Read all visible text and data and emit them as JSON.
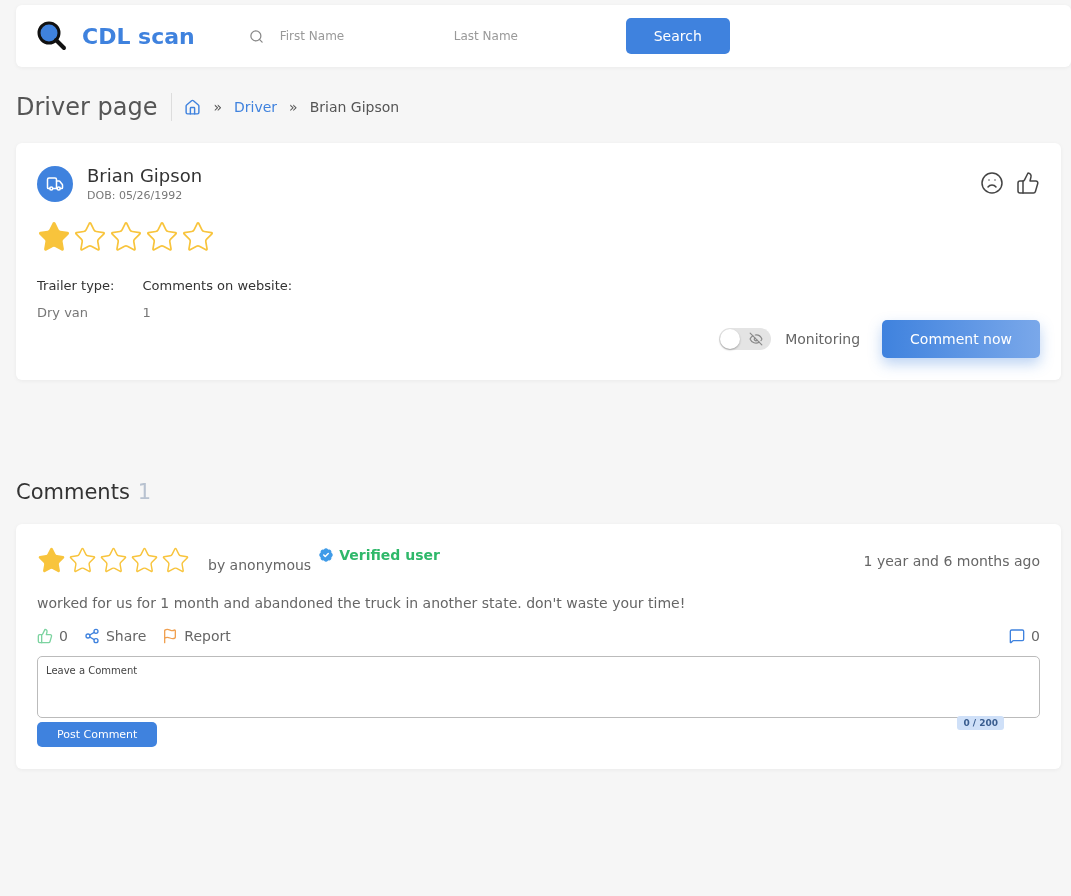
{
  "header": {
    "logo": "CDL scan",
    "search": {
      "first_name_placeholder": "First Name",
      "last_name_placeholder": "Last Name",
      "button": "Search"
    }
  },
  "page_title": "Driver page",
  "breadcrumb": [
    {
      "separator": "»",
      "label": "Driver",
      "kind": "link"
    },
    {
      "separator": "»",
      "label": "Brian Gipson",
      "kind": "current"
    }
  ],
  "driver": {
    "name": "Brian Gipson",
    "dob": "DOB: 05/26/1992",
    "stars": 1,
    "facts": [
      {
        "label": "Trailer type:",
        "value": "Dry van"
      },
      {
        "label": "Comments on website:",
        "value": "1"
      }
    ],
    "monitoring": {
      "label": "Monitoring",
      "on": false
    },
    "comment_button": "Comment now"
  },
  "comments": {
    "title": "Comments",
    "count": "1",
    "items": [
      {
        "stars": 1,
        "author": "by anonymous",
        "verified": true,
        "badge": "Verified user",
        "time": "1 year and 6 months ago",
        "text": "worked for us for 1 month and abandoned the truck in another state. don't waste your time!",
        "likes": "0",
        "share": "Share",
        "report": "Report",
        "replies": "0",
        "reply_placeholder": "Leave a Comment",
        "counter": "0 / 200",
        "post_button": "Post Comment"
      }
    ]
  }
}
